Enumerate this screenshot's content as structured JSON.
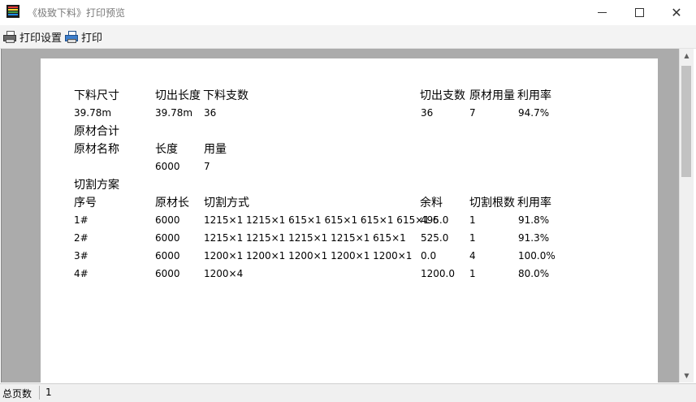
{
  "window": {
    "title": "《极致下料》打印预览"
  },
  "toolbar": {
    "print_setup": "打印设置",
    "print": "打印"
  },
  "summary": {
    "headers": {
      "length": "下料尺寸",
      "cut_length": "切出长度",
      "count": "下料支数",
      "cut_count": "切出支数",
      "material_qty": "原材用量",
      "usage_rate": "利用率"
    },
    "values": {
      "length": "39.78m",
      "cut_length": "39.78m",
      "count": "36",
      "cut_count": "36",
      "material_qty": "7",
      "usage_rate": "94.7%"
    }
  },
  "material_total": {
    "title": "原材合计",
    "headers": {
      "name": "原材名称",
      "length": "长度",
      "qty": "用量"
    },
    "row": {
      "name": "",
      "length": "6000",
      "qty": "7"
    }
  },
  "plan": {
    "title": "切割方案",
    "headers": {
      "no": "序号",
      "length": "原材长",
      "method": "切割方式",
      "remain": "余料",
      "count": "切割根数",
      "rate": "利用率"
    },
    "rows": [
      {
        "no": "1#",
        "length": "6000",
        "method": "1215×1 1215×1 615×1 615×1 615×1 615×1 6",
        "remain": "495.0",
        "count": "1",
        "rate": "91.8%"
      },
      {
        "no": "2#",
        "length": "6000",
        "method": "1215×1 1215×1 1215×1 1215×1 615×1",
        "remain": "525.0",
        "count": "1",
        "rate": "91.3%"
      },
      {
        "no": "3#",
        "length": "6000",
        "method": "1200×1 1200×1 1200×1 1200×1 1200×1",
        "remain": "0.0",
        "count": "4",
        "rate": "100.0%"
      },
      {
        "no": "4#",
        "length": "6000",
        "method": "1200×4",
        "remain": "1200.0",
        "count": "1",
        "rate": "80.0%"
      }
    ]
  },
  "statusbar": {
    "total_pages_label": "总页数",
    "total_pages": "1"
  },
  "colors": {
    "page_bg": "#ffffff",
    "preview_bg": "#ababab",
    "toolbar_bg": "#f3f3f3"
  }
}
